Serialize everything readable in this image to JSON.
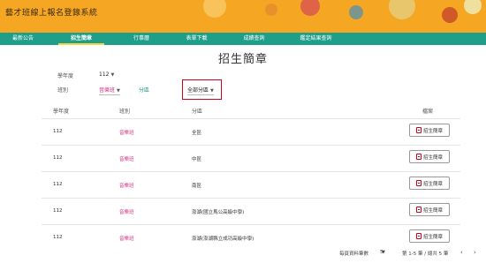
{
  "header": {
    "site_title": "藝才班線上報名登錄系統"
  },
  "nav": {
    "items": [
      {
        "label": "最新公告"
      },
      {
        "label": "招生簡章"
      },
      {
        "label": "行事曆"
      },
      {
        "label": "表單下載"
      },
      {
        "label": "成績查詢"
      },
      {
        "label": "鑑定結果查詢"
      }
    ],
    "active_index": 1
  },
  "main": {
    "title": "招生簡章",
    "filters": {
      "year_label": "學年度",
      "year_value": "112",
      "class_label": "班別",
      "class_value": "音樂班",
      "region_label": "分區",
      "region_value": "全部分區"
    },
    "table": {
      "headers": [
        "學年度",
        "班別",
        "分區",
        "檔案"
      ],
      "rows": [
        {
          "year": "112",
          "class": "音樂班",
          "region": "全區",
          "file": "招生簡章"
        },
        {
          "year": "112",
          "class": "音樂班",
          "region": "中區",
          "file": "招生簡章"
        },
        {
          "year": "112",
          "class": "音樂班",
          "region": "南區",
          "file": "招生簡章"
        },
        {
          "year": "112",
          "class": "音樂班",
          "region": "澎湖(國立馬公高級中學)",
          "file": "招生簡章"
        },
        {
          "year": "112",
          "class": "音樂班",
          "region": "澎湖(澎湖縣立成功高級中學)",
          "file": "招生簡章"
        }
      ]
    },
    "pager": {
      "rows_per_page_label": "每頁資料筆數",
      "rows_per_page": "5",
      "range": "第 1-5 筆 / 總共 5 筆",
      "prev_icon": "chevron-left-icon",
      "next_icon": "chevron-right-icon"
    }
  },
  "colors": {
    "header_bg": "#f5a623",
    "nav_bg": "#1f9e8a",
    "accent_pink": "#d63384",
    "highlight_red": "#d0021b"
  }
}
